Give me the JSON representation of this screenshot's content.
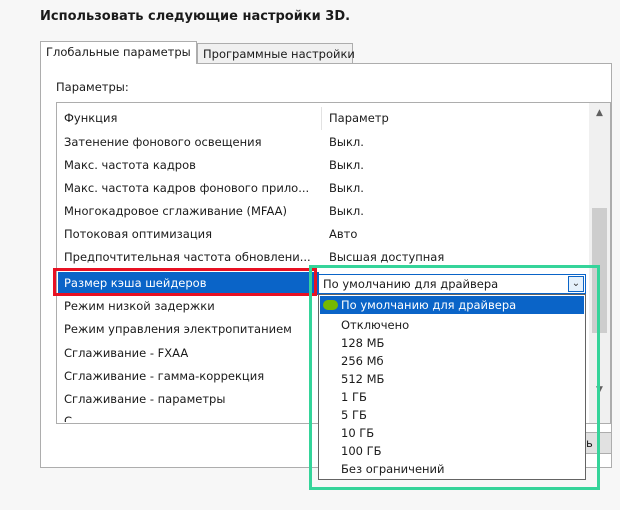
{
  "heading": "Использовать следующие настройки 3D.",
  "tabs": [
    {
      "label": "Глобальные параметры",
      "active": true
    },
    {
      "label": "Программные настройки",
      "active": false
    }
  ],
  "params_label": "Параметры:",
  "columns": {
    "function": "Функция",
    "parameter": "Параметр"
  },
  "rows": [
    {
      "name": "Затенение фонового освещения",
      "value": "Выкл."
    },
    {
      "name": "Макс. частота кадров",
      "value": "Выкл."
    },
    {
      "name": "Макс. частота кадров фонового прило...",
      "value": "Выкл."
    },
    {
      "name": "Многокадровое сглаживание (MFAA)",
      "value": "Выкл."
    },
    {
      "name": "Потоковая оптимизация",
      "value": "Авто"
    },
    {
      "name": "Предпочтительная частота обновлени...",
      "value": "Высшая доступная"
    },
    {
      "name": "Размер кэша шейдеров",
      "value": "",
      "selected": true
    },
    {
      "name": "Режим низкой задержки",
      "value": ""
    },
    {
      "name": "Режим управления электропитанием",
      "value": ""
    },
    {
      "name": "Сглаживание - FXAA",
      "value": ""
    },
    {
      "name": "Сглаживание - гамма-коррекция",
      "value": ""
    },
    {
      "name": "Сглаживание - параметры",
      "value": ""
    },
    {
      "name": "С",
      "value": ""
    }
  ],
  "combo": {
    "value": "По умолчанию для драйвера"
  },
  "dropdown_options": [
    {
      "label": "По умолчанию для драйвера",
      "highlighted": true,
      "icon": "nvidia-logo-icon"
    },
    {
      "label": "Отключено"
    },
    {
      "label": "128 МБ"
    },
    {
      "label": "256 Мб"
    },
    {
      "label": "512 МБ"
    },
    {
      "label": "1 ГБ"
    },
    {
      "label": "5 ГБ"
    },
    {
      "label": "10 ГБ"
    },
    {
      "label": "100 ГБ"
    },
    {
      "label": "Без ограничений"
    }
  ],
  "partial_button_text": "ь",
  "colors": {
    "selection": "#0a64c8",
    "highlight_red": "#e81123",
    "highlight_green": "#35d49a",
    "nvidia_green": "#76b900"
  }
}
